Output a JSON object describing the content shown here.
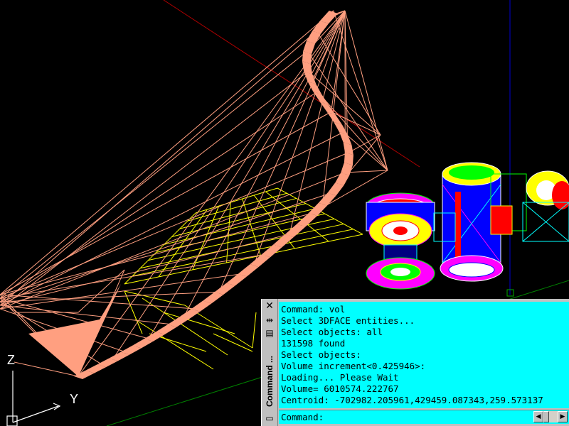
{
  "colors": {
    "viewport_bg": "#000000",
    "terrain_wire": "#ff9f80",
    "grid_wire": "#ffff00",
    "command_bg": "#00ffff",
    "palette_bg": "#c0c0c0"
  },
  "ucs": {
    "z_label": "Z",
    "y_label": "Y"
  },
  "palette": {
    "title": "Command ...",
    "close_icon": "close-icon",
    "history": [
      "Command: vol",
      "Select 3DFACE entities...",
      "Select objects: all",
      "131598 found",
      "Select objects:",
      "Volume increment<0.425946>:",
      "Loading... Please Wait",
      "Volume= 6010574.222767",
      "Centroid: -702982.205961,429459.087343,259.573137"
    ],
    "prompt": "Command:",
    "input_value": ""
  }
}
